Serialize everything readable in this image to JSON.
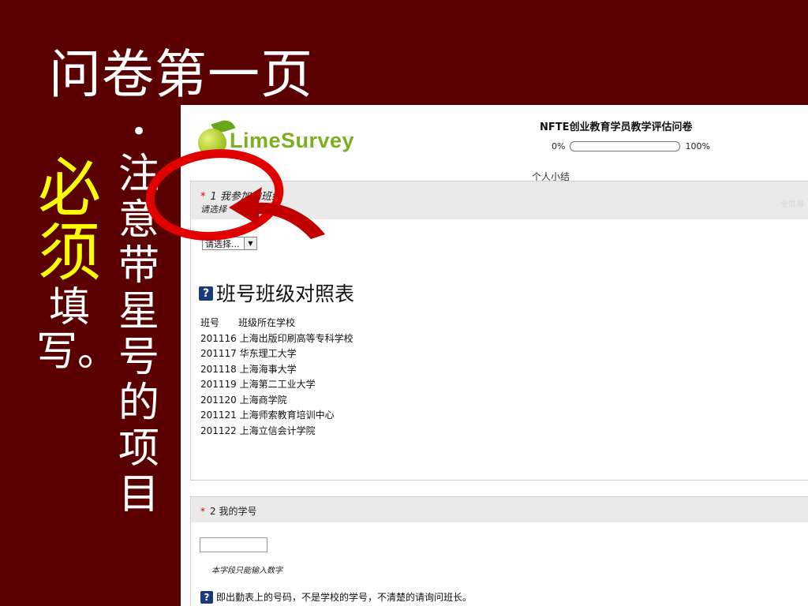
{
  "slide": {
    "title": "问卷第一页",
    "bullet_dot": "•",
    "bullet_text": "注意带星号的项目",
    "note_emphasis": "必须",
    "note_rest": "填写。"
  },
  "survey": {
    "logo_text": "LimeSurvey",
    "title": "NFTE创业教育学员教学评估问卷",
    "progress": {
      "start_label": "0%",
      "end_label": "100%",
      "value": 0
    },
    "group_name": "个人小结",
    "q1": {
      "star": "*",
      "number": "1",
      "text": "我参加的班级",
      "help": "请选择",
      "right_hint": "全屏幕",
      "select_value": "请选择...",
      "table_title": "班号班级对照表",
      "table_header": [
        "班号",
        "班级所在学校"
      ],
      "table_rows": [
        [
          "201116",
          "上海出版印刷高等专科学校"
        ],
        [
          "201117",
          "华东理工大学"
        ],
        [
          "201118",
          "上海海事大学"
        ],
        [
          "201119",
          "上海第二工业大学"
        ],
        [
          "201120",
          "上海商学院"
        ],
        [
          "201121",
          "上海师索教育培训中心"
        ],
        [
          "201122",
          "上海立信会计学院"
        ]
      ]
    },
    "q2": {
      "star": "*",
      "number": "2",
      "text": "我的学号",
      "input_value": "",
      "help": "本字段只能输入数字",
      "note": "即出勤表上的号码，不是学校的学号，不清楚的请询问班长。"
    },
    "help_icon_glyph": "?"
  },
  "colors": {
    "slide_background": "#5a0000",
    "emphasis": "#ffff00",
    "annotation_red": "#e00000",
    "logo_green": "#7cae1e"
  }
}
